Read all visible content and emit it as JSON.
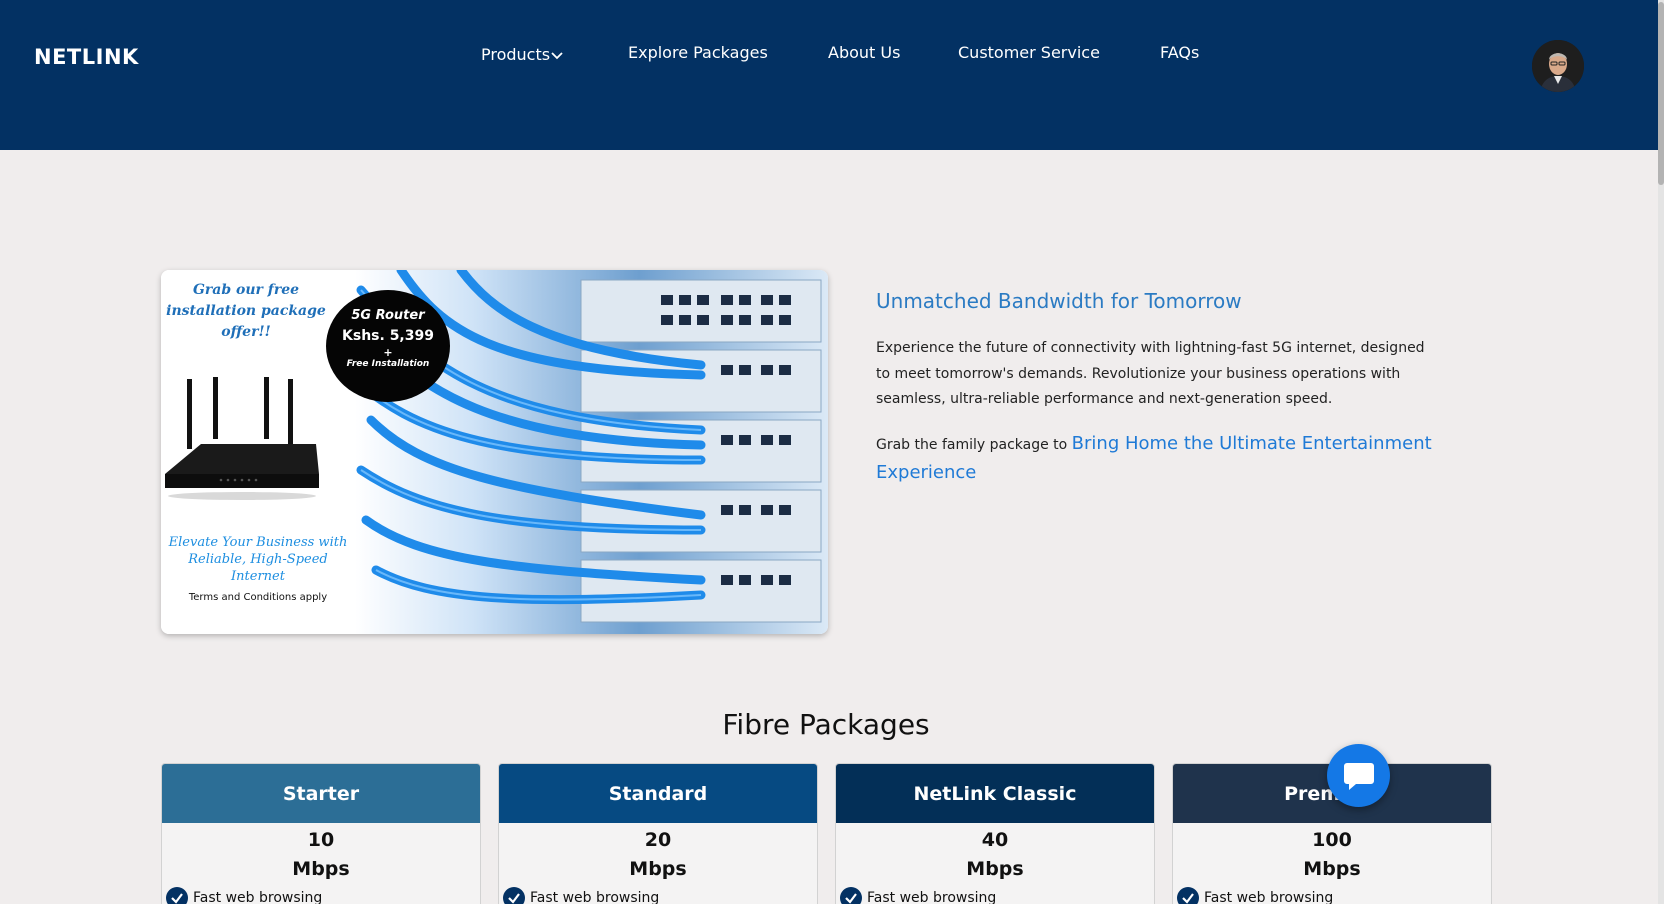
{
  "header": {
    "brand": "NETLINK",
    "nav": [
      {
        "label": "Products",
        "has_dropdown": true
      },
      {
        "label": "Explore Packages"
      },
      {
        "label": "About Us"
      },
      {
        "label": "Customer Service"
      },
      {
        "label": "FAQs"
      }
    ],
    "avatar_icon": "user-avatar"
  },
  "hero": {
    "promo_title": "Grab our free installation package offer!!",
    "badge": {
      "line1": "5G Router",
      "line2": "Kshs. 5,399",
      "line3": "+",
      "line4": "Free Installation"
    },
    "tagline": "Elevate Your Business with Reliable, High-Speed Internet",
    "terms": "Terms and Conditions apply",
    "heading": "Unmatched Bandwidth for Tomorrow",
    "description": "Experience the future of connectivity with lightning-fast 5G internet, designed to meet tomorrow's demands. Revolutionize your business operations with seamless, ultra-reliable performance and next-generation speed.",
    "cta_prefix": "Grab the family package to",
    "cta_link": "Bring Home the Ultimate Entertainment Experience"
  },
  "packages": {
    "title": "Fibre Packages",
    "plans": [
      {
        "name": "Starter",
        "speed": "10",
        "unit": "Mbps",
        "feature": "Fast web browsing",
        "color": "#2c6e96"
      },
      {
        "name": "Standard",
        "speed": "20",
        "unit": "Mbps",
        "feature": "Fast web browsing",
        "color": "#064a82"
      },
      {
        "name": "NetLink Classic",
        "speed": "40",
        "unit": "Mbps",
        "feature": "Fast web browsing",
        "color": "#032f57"
      },
      {
        "name": "Premium",
        "speed": "100",
        "unit": "Mbps",
        "feature": "Fast web browsing",
        "color": "#1f334c"
      }
    ]
  },
  "chat": {
    "icon": "chat-bubble-icon",
    "color": "#1478e6"
  },
  "colors": {
    "header_bg": "#033163",
    "page_bg": "#f0eded",
    "accent": "#2b7bc3"
  }
}
